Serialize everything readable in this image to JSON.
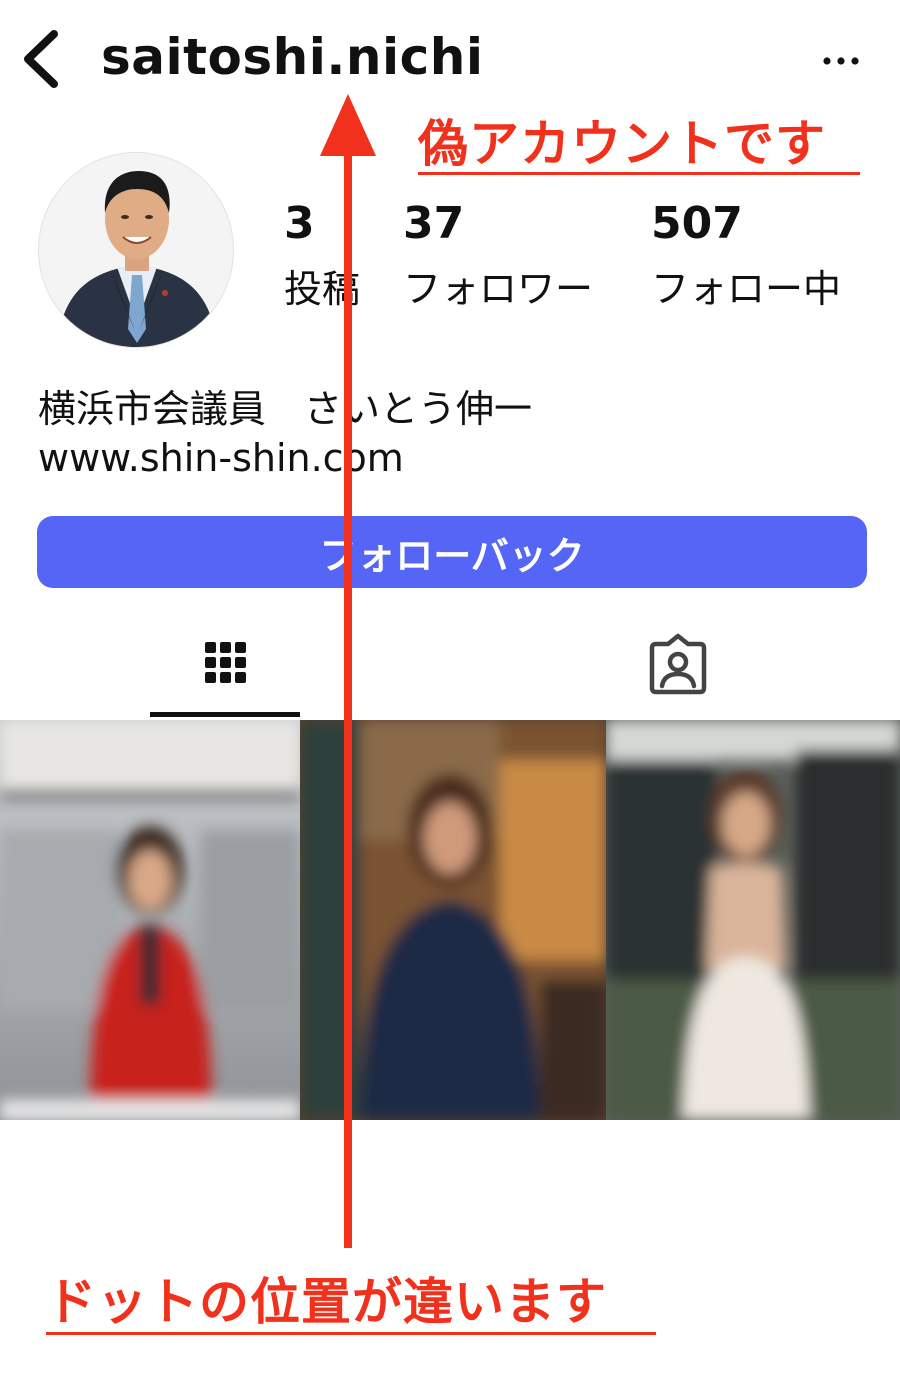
{
  "header": {
    "back_icon": "chevron-left-icon",
    "username": "saitoshi.nichi",
    "more_icon": "more-horizontal-icon"
  },
  "annotations": {
    "fake_account": "偽アカウントです",
    "dot_position": "ドットの位置が違います",
    "color": "#f2311c"
  },
  "profile": {
    "avatar_icon": "profile-photo-man-in-suit",
    "stats": [
      {
        "count": "3",
        "label": "投稿"
      },
      {
        "count": "37",
        "label": "フォロワー"
      },
      {
        "count": "507",
        "label": "フォロー中"
      }
    ],
    "bio_name": "横浜市会議員　さいとう伸一",
    "bio_link": "www.shin-shin.com"
  },
  "actions": {
    "follow_back_label": "フォローバック",
    "accent_color": "#5565f5"
  },
  "tabs": [
    {
      "name": "posts-grid",
      "icon": "grid-icon",
      "active": true
    },
    {
      "name": "tagged",
      "icon": "tagged-user-icon",
      "active": false
    }
  ],
  "posts": [
    {
      "description_icon": "blurred-photo-woman-red-jacket"
    },
    {
      "description_icon": "blurred-photo-woman-dark-top"
    },
    {
      "description_icon": "blurred-photo-woman-white-dress"
    }
  ]
}
